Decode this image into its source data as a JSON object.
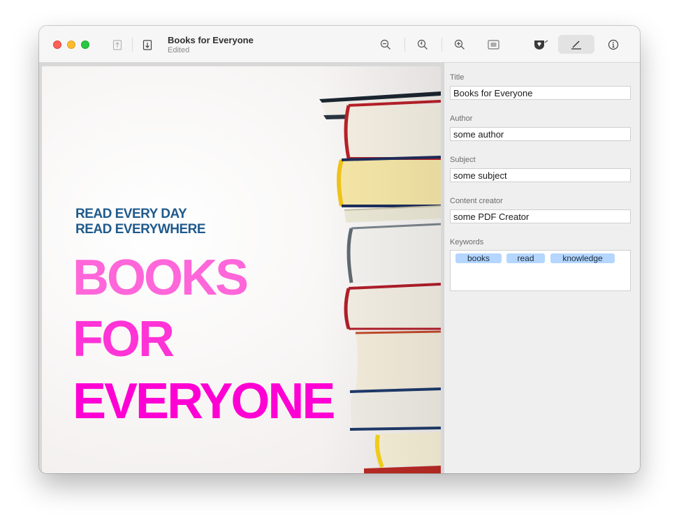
{
  "window": {
    "title": "Books for Everyone",
    "subtitle": "Edited"
  },
  "toolbar": {
    "buttons": [
      "share-icon",
      "save-icon",
      "zoom-out-icon",
      "rotate-icon",
      "zoom-in-icon",
      "thumbnail-icon",
      "highlight-icon",
      "markup-icon",
      "info-icon"
    ]
  },
  "cover": {
    "line1": "READ EVERY DAY",
    "line2": "READ EVERYWHERE",
    "word1": "BOOKS",
    "word2": "FOR",
    "word3": "EVERYONE",
    "colors": {
      "tagline": "#1f5a8c",
      "word1": "#ff66d9",
      "word2": "#ff33d6",
      "word3": "#ff00d4"
    }
  },
  "inspector": {
    "fields": [
      {
        "label": "Title",
        "value": "Books for Everyone"
      },
      {
        "label": "Author",
        "value": "some author"
      },
      {
        "label": "Subject",
        "value": "some subject"
      },
      {
        "label": "Content creator",
        "value": "some PDF Creator"
      }
    ],
    "keywords_label": "Keywords",
    "keywords": [
      "books",
      "read",
      "knowledge"
    ]
  }
}
